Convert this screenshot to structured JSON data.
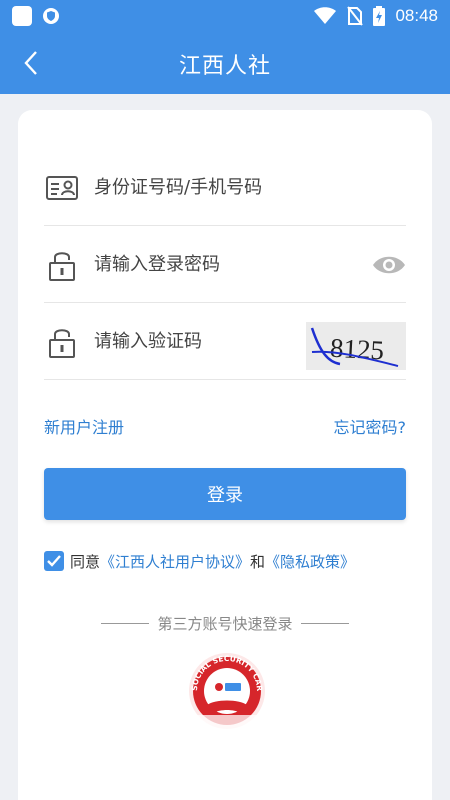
{
  "status_bar": {
    "time": "08:48",
    "icons": [
      "app-square-icon",
      "shield-icon",
      "wifi-icon",
      "no-sim-icon",
      "battery-charging-icon"
    ]
  },
  "header": {
    "title": "江西人社",
    "back_icon": "back-arrow-icon"
  },
  "form": {
    "id_field": {
      "placeholder": "身份证号码/手机号码",
      "value": "",
      "icon": "id-card-icon"
    },
    "password_field": {
      "placeholder": "请输入登录密码",
      "value": "",
      "icon": "lock-icon",
      "toggle_icon": "eye-icon"
    },
    "captcha_field": {
      "placeholder": "请输入验证码",
      "value": "",
      "icon": "lock-icon",
      "captcha_text": "8125"
    }
  },
  "links": {
    "register": "新用户注册",
    "forgot": "忘记密码?"
  },
  "login_button": "登录",
  "agreement": {
    "checked": true,
    "prefix": "同意",
    "link1": "《江西人社用户协议》",
    "and": "和",
    "link2": "《隐私政策》"
  },
  "third_party": {
    "label": "第三方账号快速登录",
    "logo_text": "SOCIAL SECURITY CARD"
  },
  "colors": {
    "primary": "#3f8fe6",
    "link": "#2f7fd1",
    "card_red": "#d6262b"
  }
}
